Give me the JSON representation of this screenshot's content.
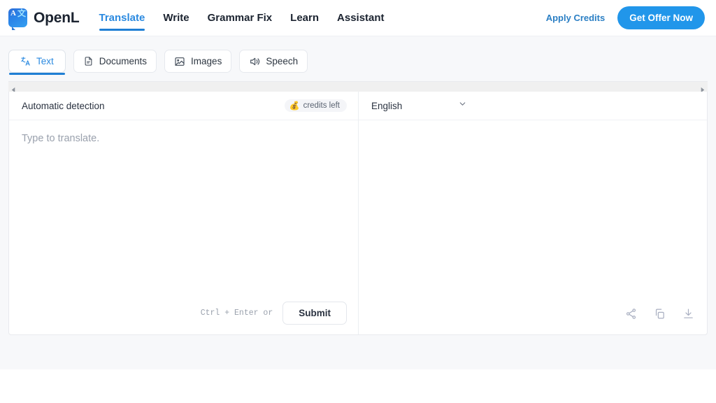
{
  "header": {
    "brand": {
      "name": "OpenL",
      "mark_letter": "A",
      "mark_cjk": "文",
      "icon": "translate-logo-icon"
    },
    "nav": [
      {
        "label": "Translate",
        "active": true
      },
      {
        "label": "Write",
        "active": false
      },
      {
        "label": "Grammar Fix",
        "active": false
      },
      {
        "label": "Learn",
        "active": false
      },
      {
        "label": "Assistant",
        "active": false
      }
    ],
    "apply_credits_label": "Apply Credits",
    "cta_label": "Get Offer Now"
  },
  "mode_tabs": [
    {
      "label": "Text",
      "icon": "translate-icon",
      "active": true
    },
    {
      "label": "Documents",
      "icon": "document-icon",
      "active": false
    },
    {
      "label": "Images",
      "icon": "image-icon",
      "active": false
    },
    {
      "label": "Speech",
      "icon": "speaker-icon",
      "active": false
    }
  ],
  "scrollbar": {
    "left_icon": "scroll-left-arrow-icon",
    "right_icon": "scroll-right-arrow-icon"
  },
  "source_pane": {
    "language": "Automatic detection",
    "credits": {
      "emoji": "💰",
      "label": "credits left",
      "icon": "money-bag-icon"
    },
    "placeholder": "Type to translate.",
    "value": "",
    "hint": "Ctrl + Enter or",
    "submit_label": "Submit"
  },
  "target_pane": {
    "language": "English",
    "dropdown_icon": "chevron-down-icon",
    "output": "",
    "actions": [
      {
        "name": "share-icon",
        "label": "Share"
      },
      {
        "name": "copy-icon",
        "label": "Copy"
      },
      {
        "name": "download-icon",
        "label": "Download"
      }
    ]
  },
  "colors": {
    "accent_blue": "#2196ea",
    "nav_active": "#2b8ae0",
    "page_bg": "#f7f8fa",
    "card_bg": "#ffffff",
    "border": "#e8eaee",
    "muted_text": "#9aa1ad"
  }
}
